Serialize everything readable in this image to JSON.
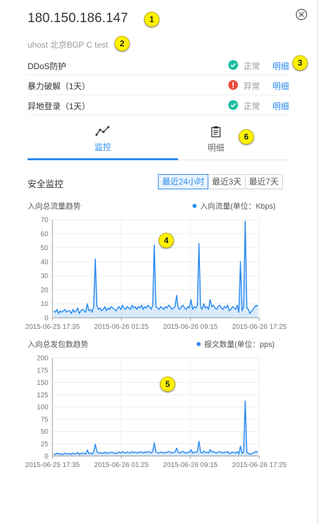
{
  "header": {
    "ip": "180.150.186.147",
    "subtitle": "uhost 北京BGP C test"
  },
  "annotations": [
    "1",
    "2",
    "3",
    "4",
    "5",
    "6"
  ],
  "status_rows": [
    {
      "name": "DDoS防护",
      "status": "正常",
      "state": "ok",
      "detail": "明细"
    },
    {
      "name": "暴力破解（1天）",
      "status": "异常",
      "state": "error",
      "detail": "明细"
    },
    {
      "name": "异地登录（1天）",
      "status": "正常",
      "state": "ok",
      "detail": "明细"
    }
  ],
  "tabs": [
    {
      "label": "监控",
      "icon": "line-chart-icon",
      "active": true
    },
    {
      "label": "明细",
      "icon": "clipboard-icon",
      "active": false
    }
  ],
  "section": {
    "title": "安全监控",
    "ranges": [
      "最近24小时",
      "最近3天",
      "最近7天"
    ],
    "active_range": "最近24小时"
  },
  "colors": {
    "accent": "#2d8cf0",
    "ok": "#19be9b",
    "error": "#ed4a3c",
    "badge": "#fff200"
  },
  "chart_data": [
    {
      "type": "area",
      "title": "入向总流量趋势",
      "legend": "入向流量(单位：Kbps)",
      "x_ticks": [
        "2015-06-25 17:35",
        "2015-06-26 01:25",
        "2015-06-26 09:15",
        "2015-06-26 17:25"
      ],
      "ylim": [
        0,
        70
      ],
      "y_ticks": [
        0,
        10,
        20,
        30,
        40,
        50,
        60,
        70
      ],
      "grid": true,
      "values": [
        5,
        4,
        6,
        3,
        5,
        4,
        5,
        6,
        4,
        5,
        5,
        3,
        6,
        4,
        5,
        7,
        3,
        5,
        6,
        5,
        4,
        10,
        5,
        6,
        4,
        8,
        42,
        9,
        6,
        7,
        5,
        6,
        8,
        5,
        7,
        6,
        8,
        7,
        6,
        5,
        7,
        8,
        6,
        9,
        7,
        6,
        8,
        7,
        6,
        9,
        7,
        8,
        6,
        8,
        7,
        9,
        6,
        8,
        7,
        9,
        8,
        6,
        9,
        52,
        8,
        7,
        6,
        8,
        7,
        6,
        8,
        7,
        9,
        8,
        6,
        7,
        8,
        16,
        7,
        6,
        8,
        9,
        7,
        6,
        8,
        7,
        13,
        6,
        8,
        7,
        9,
        53,
        8,
        6,
        10,
        7,
        8,
        6,
        13,
        8,
        9,
        7,
        6,
        8,
        9,
        7,
        6,
        8,
        7,
        9,
        5,
        6,
        8,
        7,
        6,
        9,
        4,
        40,
        5,
        8,
        69,
        7,
        6,
        3,
        5,
        6,
        8,
        9,
        8
      ]
    },
    {
      "type": "area",
      "title": "入向总发包数趋势",
      "legend": "报文数量(单位：pps)",
      "x_ticks": [
        "2015-06-25 17:35",
        "2015-06-26 01:25",
        "2015-06-26 09:15",
        "2015-06-26 17:25"
      ],
      "ylim": [
        0,
        200
      ],
      "y_ticks": [
        0,
        25,
        50,
        75,
        100,
        125,
        150,
        175,
        200
      ],
      "grid": true,
      "values": [
        5,
        3,
        6,
        4,
        5,
        3,
        4,
        6,
        4,
        5,
        5,
        3,
        6,
        4,
        5,
        7,
        3,
        5,
        6,
        5,
        4,
        12,
        5,
        6,
        4,
        8,
        24,
        9,
        6,
        7,
        5,
        6,
        8,
        5,
        7,
        6,
        8,
        7,
        6,
        5,
        7,
        8,
        6,
        9,
        7,
        6,
        8,
        7,
        6,
        9,
        7,
        8,
        6,
        8,
        7,
        9,
        6,
        8,
        7,
        9,
        8,
        6,
        9,
        27,
        8,
        7,
        6,
        8,
        7,
        6,
        8,
        7,
        9,
        8,
        6,
        7,
        8,
        16,
        7,
        6,
        8,
        9,
        7,
        6,
        8,
        7,
        13,
        6,
        8,
        7,
        9,
        30,
        8,
        6,
        10,
        7,
        8,
        6,
        13,
        8,
        9,
        7,
        6,
        8,
        9,
        7,
        6,
        8,
        7,
        9,
        5,
        6,
        8,
        7,
        6,
        9,
        4,
        20,
        5,
        8,
        112,
        7,
        6,
        3,
        5,
        6,
        8,
        9,
        8
      ]
    }
  ]
}
